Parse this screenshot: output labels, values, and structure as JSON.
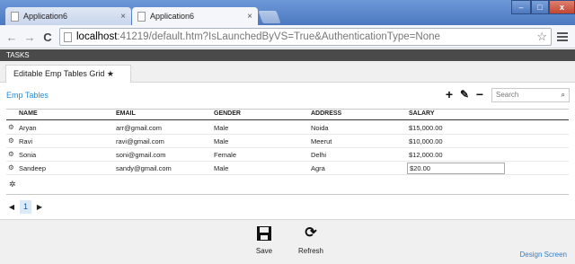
{
  "browser": {
    "tabs": [
      {
        "label": "Application6",
        "close": "×"
      },
      {
        "label": "Application6",
        "close": "×"
      }
    ],
    "window_controls": {
      "minimize": "–",
      "maximize": "□",
      "close": "x"
    },
    "nav": {
      "back": "←",
      "forward": "→",
      "reload": "C"
    },
    "address": {
      "host": "localhost",
      "rest": ":41219/default.htm?IsLaunchedByVS=True&AuthenticationType=None"
    },
    "star": "☆"
  },
  "tasks": {
    "label": "TASKS"
  },
  "subtab": {
    "label": "Editable Emp Tables Grid",
    "pin": "★"
  },
  "screen": {
    "title": "Emp Tables",
    "actions": {
      "add": "+",
      "edit": "✎",
      "delete": "−"
    },
    "search": {
      "placeholder": "Search",
      "icon": "⌕"
    }
  },
  "grid": {
    "columns": [
      "NAME",
      "EMAIL",
      "GENDER",
      "ADDRESS",
      "SALARY"
    ],
    "rows": [
      {
        "name": "Aryan",
        "email": "arr@gmail.com",
        "gender": "Male",
        "address": "Noida",
        "salary": "$15,000.00"
      },
      {
        "name": "Ravi",
        "email": "ravi@gmail.com",
        "gender": "Male",
        "address": "Meerut",
        "salary": "$10,000.00"
      },
      {
        "name": "Sonia",
        "email": "soni@gmail.com",
        "gender": "Female",
        "address": "Delhi",
        "salary": "$12,000.00"
      },
      {
        "name": "Sandeep",
        "email": "sandy@gmail.com",
        "gender": "Male",
        "address": "Agra",
        "salary": "$20.00"
      }
    ],
    "row_icon": "⚙",
    "new_row_icon": "✲"
  },
  "pager": {
    "prev": "◀",
    "page": "1",
    "next": "▶"
  },
  "footer": {
    "save": {
      "label": "Save",
      "icon": "💾"
    },
    "refresh": {
      "label": "Refresh",
      "icon": "⟳"
    },
    "design": "Design Screen"
  },
  "colors": {
    "accent": "#2a8ad4",
    "tasks_bar": "#4a4a4a",
    "titlebar": "#4b78c0"
  }
}
